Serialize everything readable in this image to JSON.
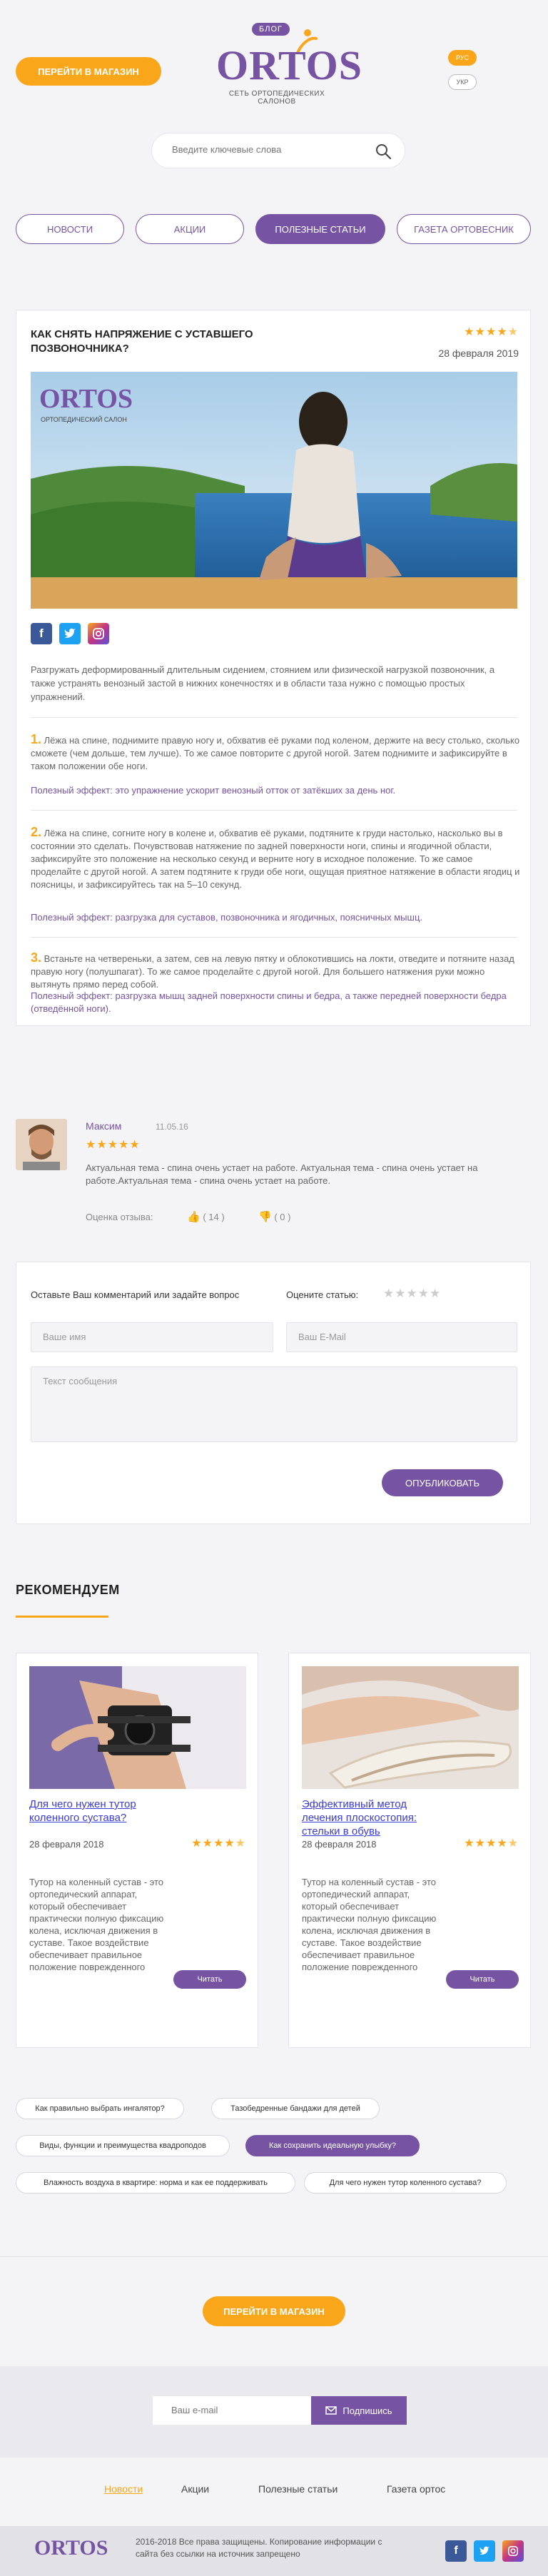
{
  "header": {
    "shop_button": "ПЕРЕЙТИ В МАГАЗИН",
    "blog_badge": "БЛОГ",
    "logo": "ORTOS",
    "logo_sub": "СЕТЬ ОРТОПЕДИЧЕСКИХ САЛОНОВ",
    "lang_ru": "РУС",
    "lang_uk": "УКР"
  },
  "search": {
    "placeholder": "Введите ключевые слова"
  },
  "tabs": [
    {
      "label": "НОВОСТИ"
    },
    {
      "label": "АКЦИИ"
    },
    {
      "label": "ПОЛЕЗНЫЕ СТАТЬИ"
    },
    {
      "label": "ГАЗЕТА ОРТОВЕСНИК"
    }
  ],
  "article": {
    "title": "КАК СНЯТЬ НАПРЯЖЕНИЕ С УСТАВШЕГО ПОЗВОНОЧНИКА?",
    "rating": 4.5,
    "date": "28 февраля 2019",
    "hero_logo": "ORTOS",
    "hero_logo_sub": "ОРТОПЕДИЧЕСКИЙ САЛОН",
    "intro": "Разгружать деформированный длительным сидением, стоянием или физической нагрузкой позвоночник, а также устранять венозный застой в нижних конечностях и в области таза нужно с помощью простых упражнений.",
    "steps": [
      {
        "num": "1.",
        "text": "Лёжа на спине, поднимите правую ногу и, обхватив её руками под коленом, держите на весу столько, сколько сможете (чем дольше, тем лучше). То же самое повторите с другой ногой. Затем поднимите и зафиксируйте в таком положении обе ноги.",
        "effect_label": "Полезный эффект:",
        "effect": "это упражнение ускорит венозный отток от затёкших за день ног."
      },
      {
        "num": "2.",
        "text": "Лёжа на спине, согните ногу в колене и, обхватив её руками, подтяните к груди настолько, насколько вы в состоянии это сделать. Почувствовав натяжение по задней поверхности ноги, спины и ягодичной области, зафиксируйте это положение на несколько секунд и верните ногу в исходное положение. То же самое проделайте с другой ногой. А затем подтяните к груди обе ноги, ощущая приятное натяжение в области ягодиц и поясницы, и зафиксируйтесь так на 5–10 секунд.",
        "effect_label": "Полезный эффект:",
        "effect": "разгрузка для суставов, позвоночника и ягодичных, поясничных мышц."
      },
      {
        "num": "3.",
        "text": "Встаньте на четвереньки, а затем, сев на левую пятку и облокотившись на локти, отведите и потяните назад правую ногу (полушпагат). То же самое проделайте с другой ногой. Для большего натяжения руки можно вытянуть прямо перед собой.",
        "effect_label": "Полезный эффект:",
        "effect": "разгрузка мышц задней поверхности спины и бедра, а также передней поверхности бедра (отведённой ноги)."
      }
    ]
  },
  "comment": {
    "name": "Максим",
    "date": "11.05.16",
    "rating": 5,
    "text": "Актуальная тема - спина очень устает на работе. Актуальная тема - спина очень устает на работе.Актуальная тема - спина очень устает на работе.",
    "rate_label": "Оценка отзыва:",
    "likes": "( 14 )",
    "dislikes": "( 0 )"
  },
  "form": {
    "heading": "Оставьте Ваш комментарий или задайте вопрос",
    "rate_label": "Оцените статью:",
    "name_placeholder": "Ваше имя",
    "email_placeholder": "Ваш E-Mail",
    "message_placeholder": "Текст сообщения",
    "submit": "ОПУБЛИКОВАТЬ"
  },
  "recommend": {
    "title": "РЕКОМЕНДУЕМ",
    "cards": [
      {
        "title": "Для чего нужен тутор коленного сустава?",
        "date": "28 февраля 2018",
        "rating": 4.5,
        "text": "Тутор на коленный сустав - это ортопедический аппарат, который обеспечивает практически полную фиксацию колена, исключая движения в суставе. Такое воздействие обеспечивает правильное положение поврежденного",
        "button": "Читать"
      },
      {
        "title": "Эффективный метод лечения плоскостопия: стельки в обувь",
        "date": "28 февраля 2018",
        "rating": 4.5,
        "text": "Тутор на коленный сустав - это ортопедический аппарат, который обеспечивает практически полную фиксацию колена, исключая движения в суставе. Такое воздействие обеспечивает правильное положение поврежденного",
        "button": "Читать"
      }
    ]
  },
  "tags": [
    "Как правильно выбрать ингалятор?",
    "Тазобедренные бандажи для детей",
    "Виды, функции и преимущества квадроподов",
    "Как сохранить идеальную улыбку?",
    "Влажность воздуха в квартире: норма и как ее поддерживать",
    "Для чего нужен тутор коленного сустава?"
  ],
  "bottom_cta": "ПЕРЕЙТИ В МАГАЗИН",
  "subscribe": {
    "placeholder": "Ваш e-mail",
    "button": "Подпишись"
  },
  "footer_nav": [
    "Новости",
    "Акции",
    "Полезные статьи",
    "Газета ортос"
  ],
  "footer": {
    "logo": "ORTOS",
    "copyright": "2016-2018 Все права защищены. Копирование информации с сайта без ссылки на источник запрещено"
  },
  "colors": {
    "accent": "#f9a61a",
    "brand": "#7654a3",
    "facebook": "#3b5998",
    "twitter": "#1da1f2",
    "instagram": "#c13584"
  }
}
